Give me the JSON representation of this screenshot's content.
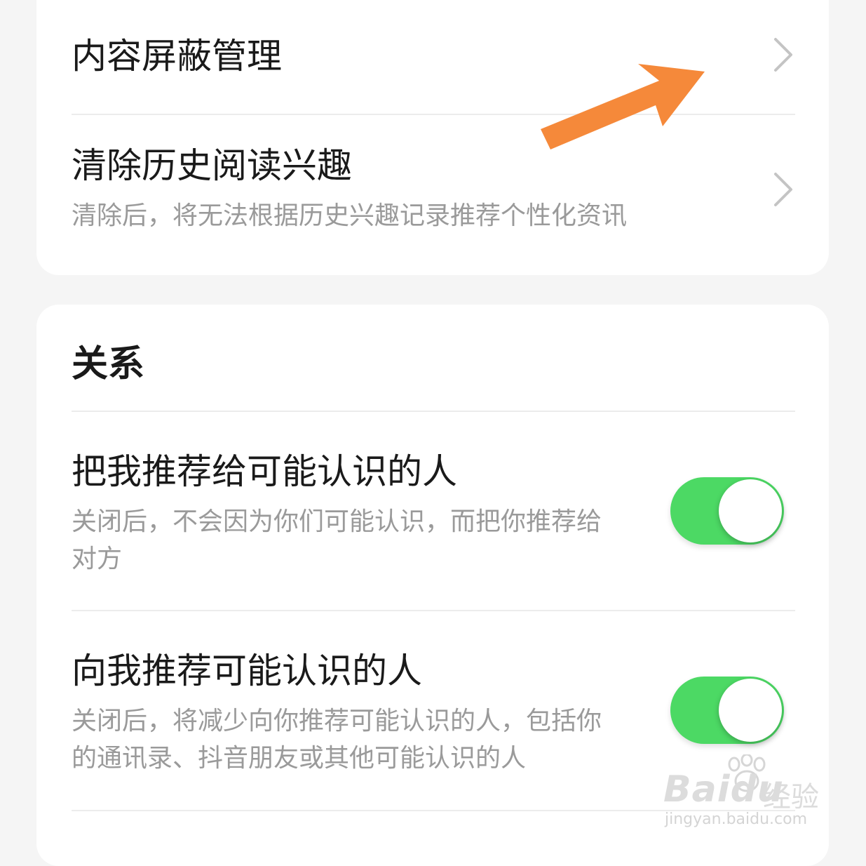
{
  "privacy": {
    "content_block": {
      "label": "内容屏蔽管理"
    },
    "clear_history": {
      "label": "清除历史阅读兴趣",
      "description": "清除后，将无法根据历史兴趣记录推荐个性化资讯"
    }
  },
  "relations": {
    "header": "关系",
    "items": [
      {
        "label": "把我推荐给可能认识的人",
        "description_line1": "关闭后，不会因为你们可能认识，而把你推荐给",
        "description_line2": "对方",
        "enabled": true
      },
      {
        "label": "向我推荐可能认识的人",
        "description_line1": "关闭后，将减少向你推荐可能认识的人，包括你",
        "description_line2": "的通讯录、抖音朋友或其他可能认识的人",
        "enabled": true
      }
    ]
  },
  "annotation": {
    "color": "#f5893a"
  },
  "watermark": {
    "logo": "Bai",
    "logo2": "du",
    "label": "经验",
    "url": "jingyan.baidu.com"
  },
  "colors": {
    "toggle_on": "#4cd964",
    "background": "#f5f5f5"
  }
}
